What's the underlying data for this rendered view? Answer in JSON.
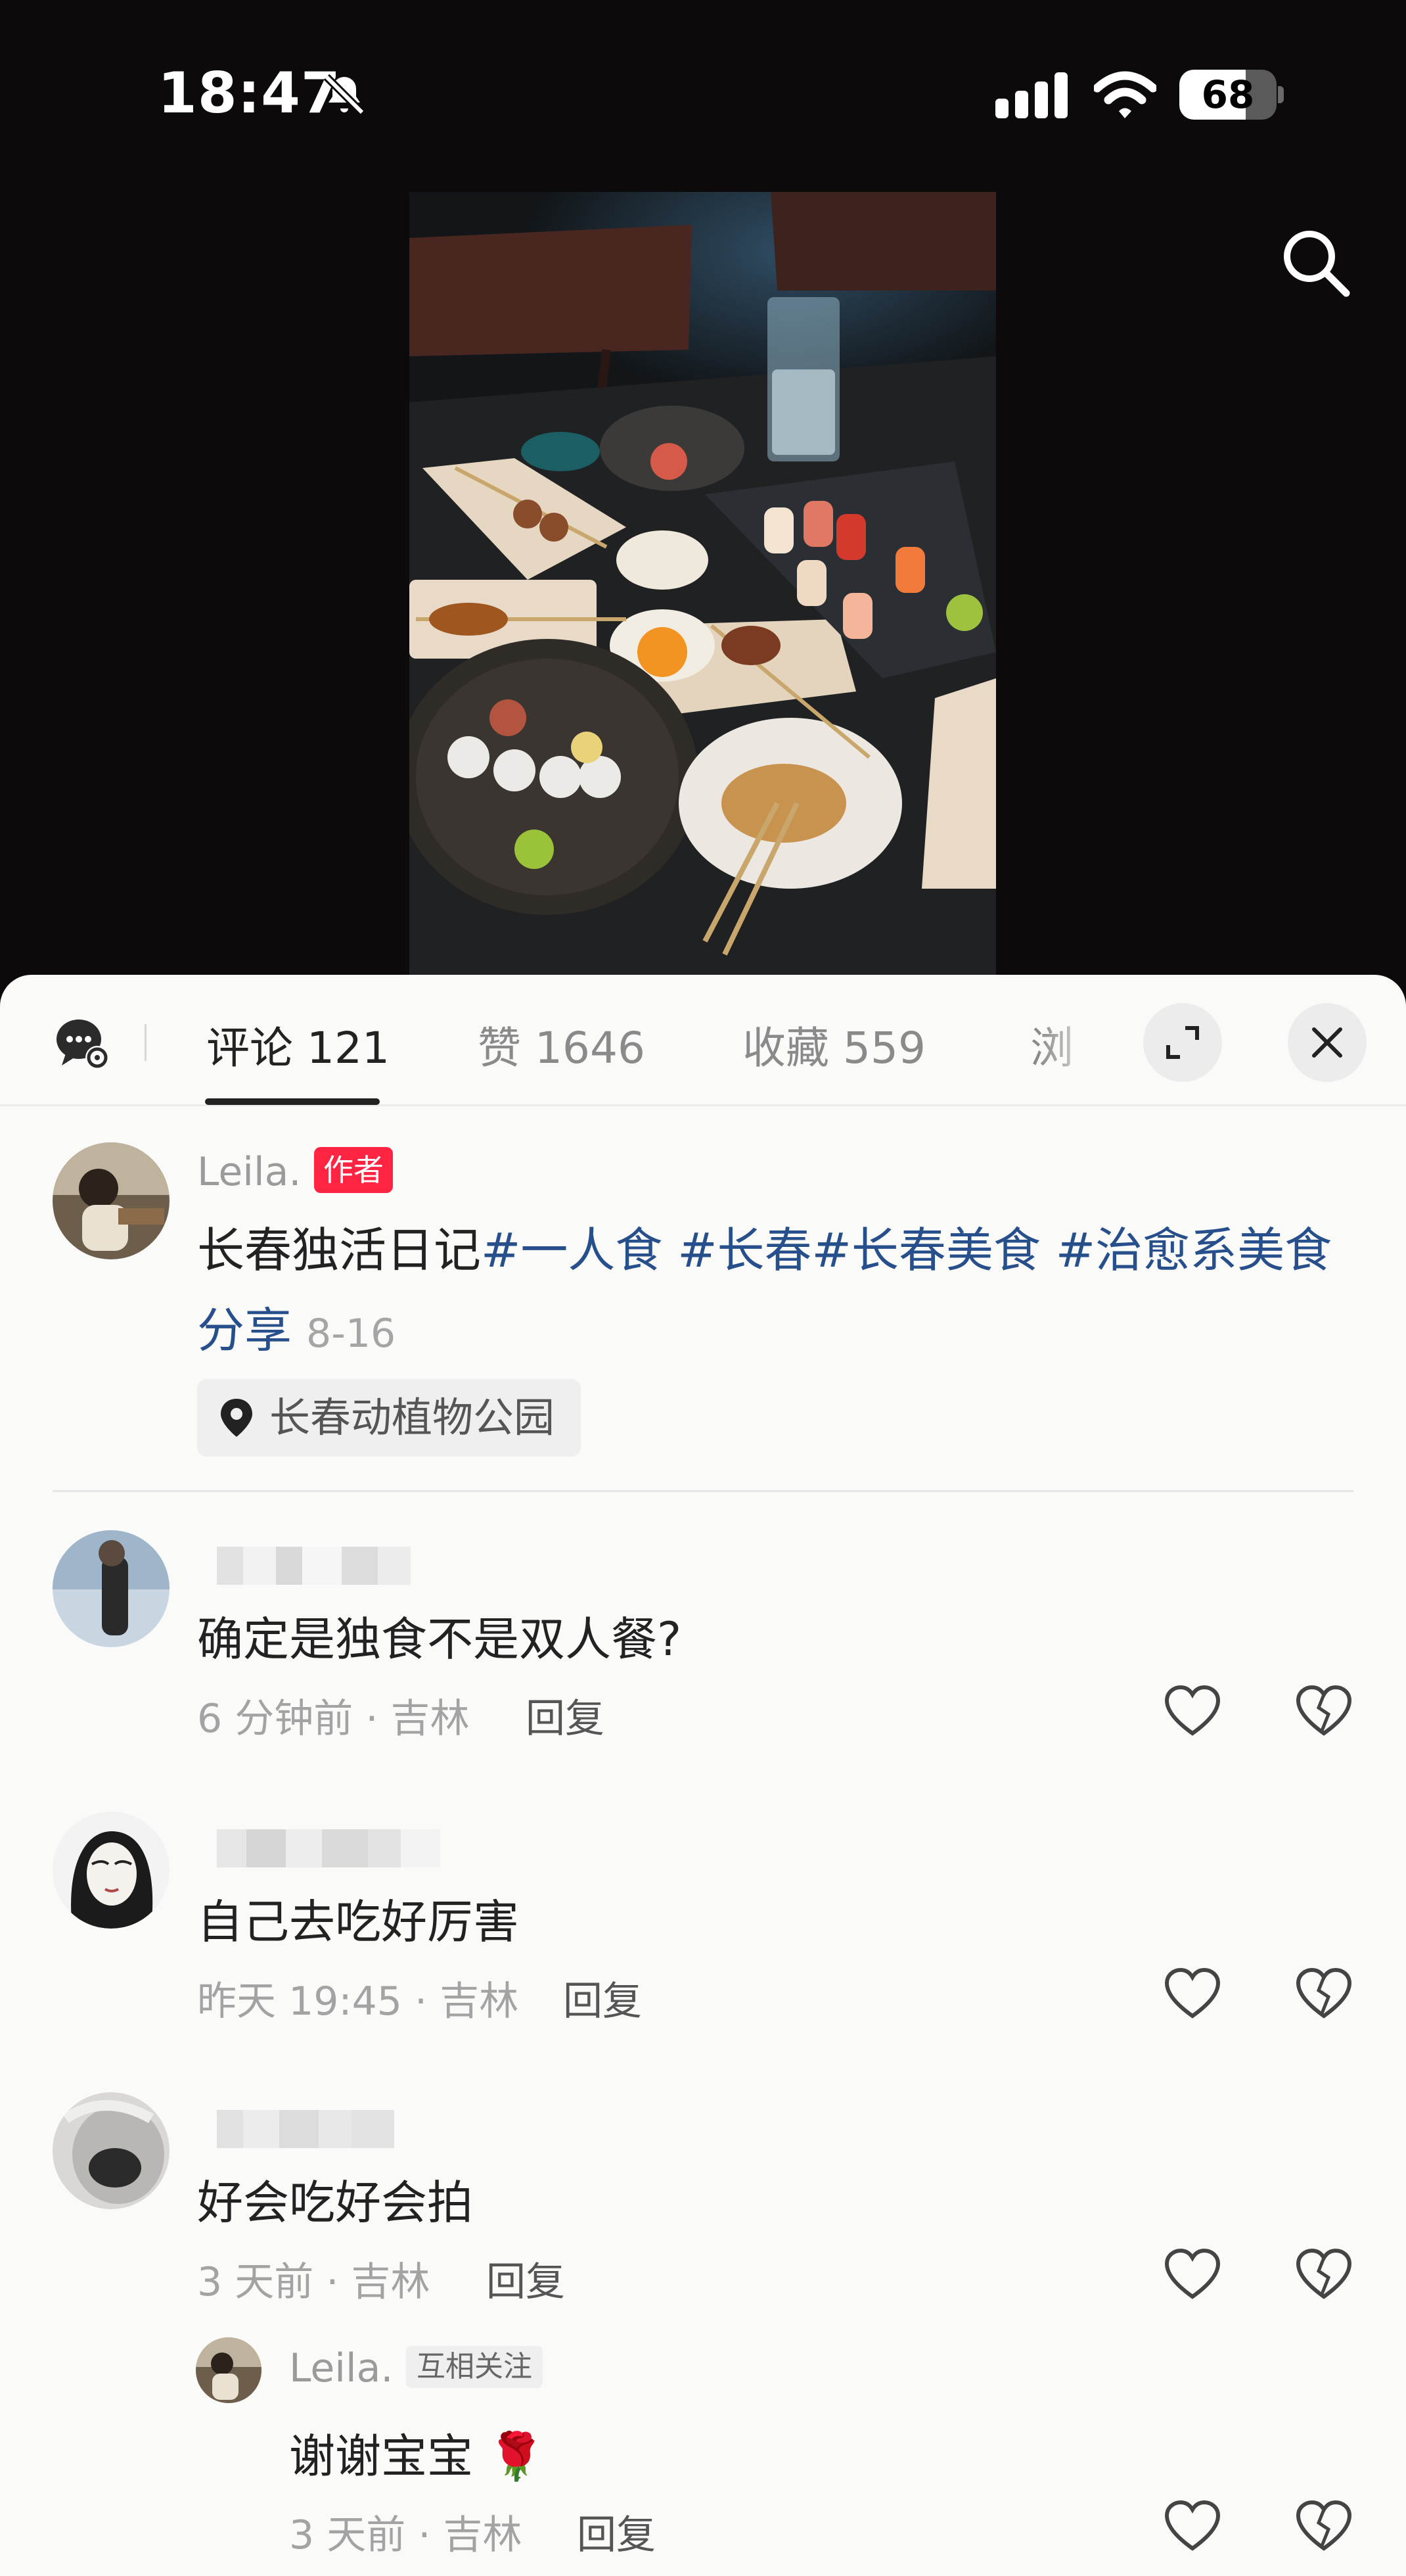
{
  "status_bar": {
    "time": "18:47",
    "battery": "68",
    "battery_level": 0.68,
    "icons": [
      "bell-muted-icon",
      "signal-icon",
      "wifi-icon",
      "battery-icon"
    ]
  },
  "header": {
    "search_icon": "search-icon"
  },
  "tabs": [
    {
      "label": "评论 121"
    },
    {
      "label": "赞 1646"
    },
    {
      "label": "收藏 559"
    },
    {
      "label": "浏"
    }
  ],
  "actions": {
    "expand_icon": "expand-icon",
    "close_icon": "close-icon",
    "chat_icon": "chat-settings-icon"
  },
  "post": {
    "author": "Leila.",
    "author_badge": "作者",
    "text": "长春独活日记",
    "tags": "#一人食 #长春#长春美食 #治愈系美食分享",
    "date": "8-16",
    "location": "长春动植物公园"
  },
  "comments": [
    {
      "text": "确定是独食不是双人餐?",
      "meta": "6 分钟前 · 吉林",
      "reply_label": "回复"
    },
    {
      "text": "自己去吃好厉害",
      "meta": "昨天 19:45 · 吉林",
      "reply_label": "回复"
    },
    {
      "text": "好会吃好会拍",
      "meta": "3 天前 · 吉林",
      "reply_label": "回复"
    }
  ],
  "sub_reply": {
    "author": "Leila.",
    "badge": "互相关注",
    "text": "谢谢宝宝 🌹",
    "meta": "3 天前 · 吉林",
    "reply_label": "回复"
  },
  "colors": {
    "accent": "#ff2442",
    "tag_blue": "#274f8c",
    "sheet_bg": "#fafaf9"
  }
}
